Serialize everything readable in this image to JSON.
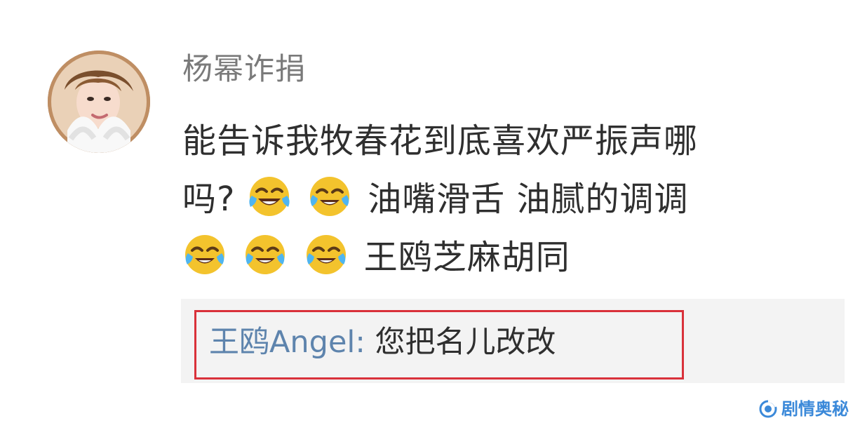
{
  "comment": {
    "username": "杨幂诈捐",
    "line1": "能告诉我牧春花到底喜欢严振声哪",
    "line2_prefix": "吗?",
    "line2_suffix": "油嘴滑舌  油腻的调调",
    "line3_suffix": "王鸥芝麻胡同",
    "emoji_icons": [
      "laughing-crying-emoji",
      "laughing-crying-emoji",
      "laughing-crying-emoji",
      "laughing-crying-emoji",
      "laughing-crying-emoji"
    ]
  },
  "reply": {
    "username": "王鸥Angel",
    "colon": ": ",
    "text": "您把名儿改改"
  },
  "watermark": {
    "text": "剧情奥秘",
    "icon": "watermark-logo-icon"
  },
  "colors": {
    "username": "#7a7a7a",
    "comment_text": "#2f2f2f",
    "reply_user": "#5e84ad",
    "reply_background": "#f3f3f3",
    "highlight_border": "#d9313a",
    "watermark": "#3b89d9"
  }
}
